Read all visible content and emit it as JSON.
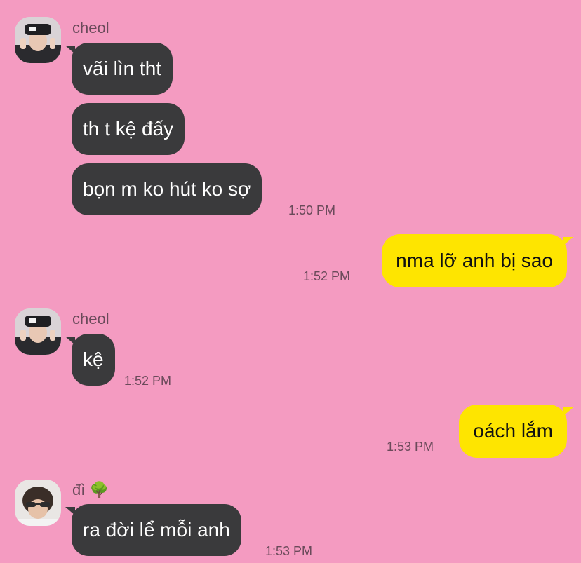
{
  "messages": [
    {
      "sender": "cheol",
      "text": "vãi lìn tht"
    },
    {
      "text": "th t kệ đấy"
    },
    {
      "text": "bọn m ko hút ko sợ",
      "time": "1:50 PM"
    },
    {
      "outgoing": true,
      "text": "nma lỡ anh bị sao",
      "time": "1:52 PM"
    },
    {
      "sender": "cheol",
      "text": "kệ",
      "time": "1:52 PM"
    },
    {
      "outgoing": true,
      "text": "oách lắm",
      "time": "1:53 PM"
    },
    {
      "sender": "đì",
      "sender_emoji": "🌳",
      "text": "ra đời lể mỗi anh",
      "time": "1:53 PM"
    }
  ],
  "colors": {
    "background": "#F49BC1",
    "incoming_bubble": "#3A3A3C",
    "outgoing_bubble": "#FEE500",
    "meta_text": "#6A4A5A"
  }
}
